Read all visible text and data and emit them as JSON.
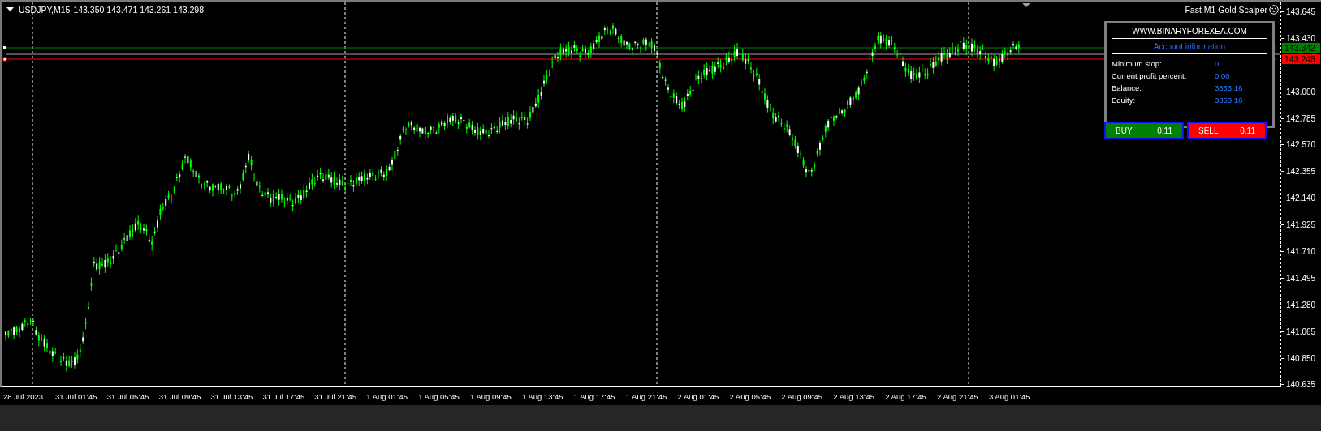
{
  "chart": {
    "symbol": "USDJPY,M15",
    "ohlc": "143.350 143.471 143.261 143.298",
    "expert": "Fast M1 Gold Scalper",
    "price_labels": [
      "143.645",
      "143.430",
      "143.000",
      "142.785",
      "142.570",
      "142.355",
      "142.140",
      "141.925",
      "141.710",
      "141.495",
      "141.280",
      "141.065",
      "140.850",
      "140.635"
    ],
    "price_tags": [
      {
        "text": "143.342",
        "color": "#008000"
      },
      {
        "text": "143.248",
        "color": "#ff0000"
      }
    ],
    "time_labels": [
      "28 Jul 2023",
      "31 Jul 01:45",
      "31 Jul 05:45",
      "31 Jul 09:45",
      "31 Jul 13:45",
      "31 Jul 17:45",
      "31 Jul 21:45",
      "1 Aug 01:45",
      "1 Aug 05:45",
      "1 Aug 09:45",
      "1 Aug 13:45",
      "1 Aug 17:45",
      "1 Aug 21:45",
      "2 Aug 01:45",
      "2 Aug 05:45",
      "2 Aug 09:45",
      "2 Aug 13:45",
      "2 Aug 17:45",
      "2 Aug 21:45",
      "3 Aug 01:45"
    ]
  },
  "panel": {
    "website": "WWW.BINARYFOREXEA.COM",
    "heading": "Account information",
    "rows": [
      {
        "label": "Minimum stop:",
        "value": "0"
      },
      {
        "label": "Current profit percent:",
        "value": "0.00"
      },
      {
        "label": "Balance:",
        "value": "3853.16"
      },
      {
        "label": "Equity:",
        "value": "3853.16"
      }
    ],
    "buttons": [
      {
        "kind": "buy",
        "label": "BUY",
        "lot": "0.11"
      },
      {
        "kind": "sell",
        "label": "SELL",
        "lot": "0.11"
      }
    ]
  }
}
